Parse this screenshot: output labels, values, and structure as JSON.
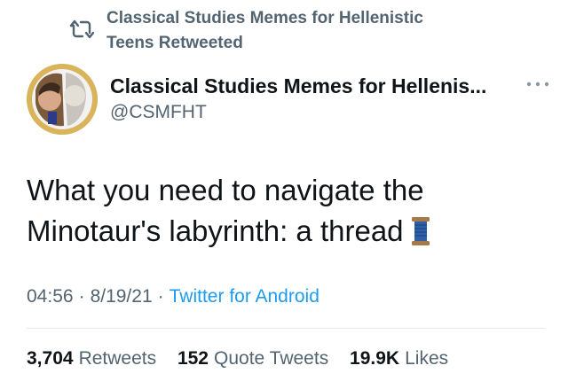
{
  "retweet": {
    "icon": "retweet-icon",
    "text_line1": "Classical Studies Memes for Hellenistic",
    "text_line2": "Teens Retweeted"
  },
  "author": {
    "avatar": "avatar",
    "name": "Classical Studies Memes for Hellenis...",
    "handle": "@CSMFHT",
    "more_icon": "more-icon"
  },
  "tweet": {
    "line1": "What you need to navigate the",
    "line2": "Minotaur's labyrinth: a thread",
    "emoji_icon": "spool-of-thread-icon"
  },
  "meta": {
    "time": "04:56",
    "date": "8/19/21",
    "source": "Twitter for Android",
    "separator": "·"
  },
  "stats": {
    "retweets_count": "3,704",
    "retweets_label": "Retweets",
    "quotes_count": "152",
    "quotes_label": "Quote Tweets",
    "likes_count": "19.9K",
    "likes_label": "Likes"
  },
  "colors": {
    "text_primary": "#0f1419",
    "text_secondary": "#536471",
    "link": "#1d9bf0"
  }
}
